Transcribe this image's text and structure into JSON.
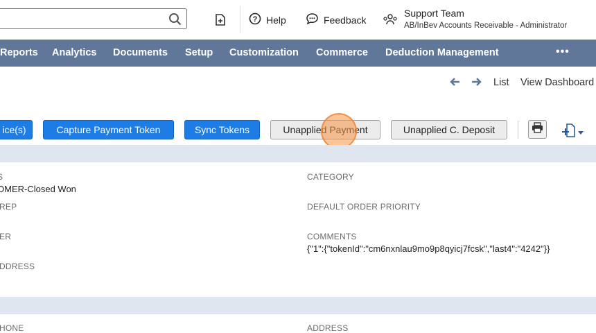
{
  "header": {
    "search_placeholder": "",
    "help_label": "Help",
    "feedback_label": "Feedback",
    "user_name": "Support Team",
    "user_role": "AB/InBev Accounts Receivable - Administrator"
  },
  "nav": {
    "items": [
      "Reports",
      "Analytics",
      "Documents",
      "Setup",
      "Customization",
      "Commerce",
      "Deduction Management"
    ],
    "more_label": "•••"
  },
  "subnav": {
    "list_label": "List",
    "dashboard_label": "View Dashboard"
  },
  "toolbar": {
    "buttons": [
      "ice(s)",
      "Capture Payment Token",
      "Sync Tokens",
      "Unapplied Payment",
      "Unapplied C. Deposit"
    ]
  },
  "fields": {
    "status_label": "S",
    "status_value": "OMER-Closed Won",
    "category_label": "CATEGORY",
    "sales_rep_label": "REP",
    "default_order_priority_label": "DEFAULT ORDER PRIORITY",
    "partner_label": "ER",
    "comments_label": "COMMENTS",
    "comments_value": "{\"1\":{\"tokenId\":\"cm6nxnlau9mo9p8qyicj7fcsk\",\"last4\":\"4242\"}}",
    "address_left_label": "DDRESS",
    "phone_label": "HONE",
    "address_label": "ADDRESS"
  }
}
